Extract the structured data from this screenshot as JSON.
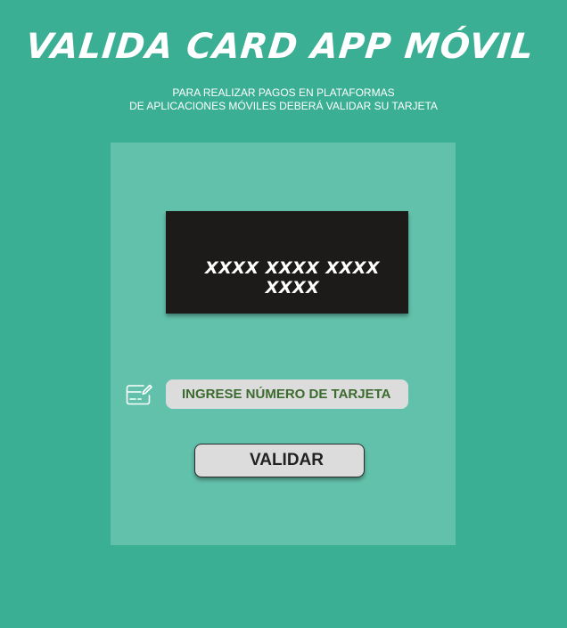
{
  "header": {
    "title": "VALIDA CARD APP MÓVIL",
    "subtitle_line1": "PARA REALIZAR PAGOS EN PLATAFORMAS",
    "subtitle_line2": "DE APLICACIONES MÓVILES DEBERÁ VALIDAR SU TARJETA"
  },
  "card": {
    "number_mask": "XXXX XXXX XXXX XXXX"
  },
  "form": {
    "card_input_placeholder": "INGRESE NÚMERO DE TARJETA",
    "card_input_value": "",
    "input_icon": "card-edit-icon",
    "validate_label": "VALIDAR"
  },
  "colors": {
    "background": "#3aaf93",
    "panel": "#62c1ab",
    "card": "#1c1b1a",
    "input": "#dcdcdc",
    "input_text": "#3c6b2f"
  }
}
